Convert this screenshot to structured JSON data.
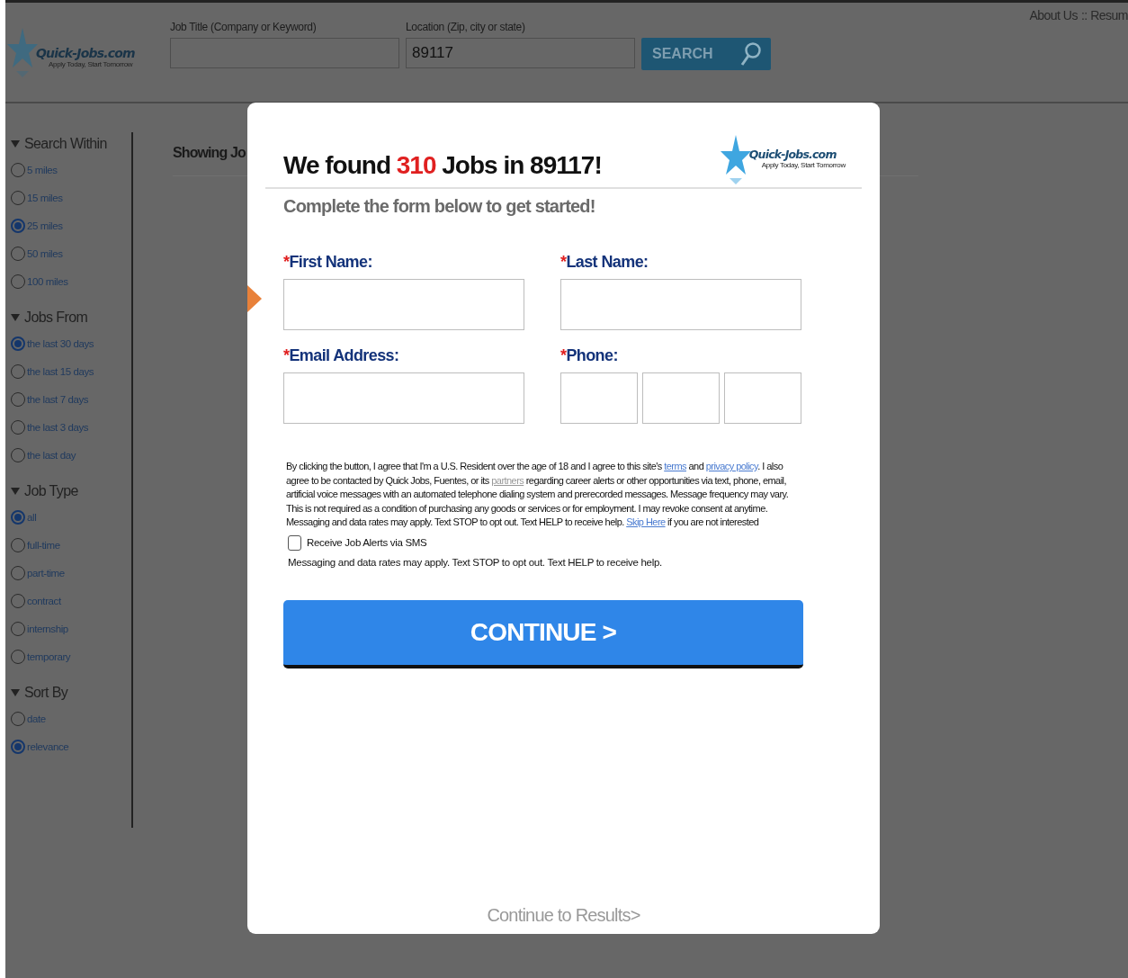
{
  "header": {
    "logo": {
      "name": "Quick-Jobs.com",
      "tagline": "Apply Today, Start Tomorrow"
    },
    "job_title_field": {
      "label": "Job Title (Company or Keyword)"
    },
    "location_field": {
      "label": "Location (Zip, city or state)",
      "value": "89117"
    },
    "search_button": "SEARCH",
    "top_links": [
      "About Us",
      ":: Resum"
    ]
  },
  "sidebar": [
    {
      "heading": "Search Within",
      "options": [
        {
          "label": "5 miles",
          "selected": false
        },
        {
          "label": "15 miles",
          "selected": false
        },
        {
          "label": "25 miles",
          "selected": true
        },
        {
          "label": "50 miles",
          "selected": false
        },
        {
          "label": "100 miles",
          "selected": false
        }
      ]
    },
    {
      "heading": "Jobs From",
      "options": [
        {
          "label": "the last 30 days",
          "selected": true
        },
        {
          "label": "the last 15 days",
          "selected": false
        },
        {
          "label": "the last 7 days",
          "selected": false
        },
        {
          "label": "the last 3 days",
          "selected": false
        },
        {
          "label": "the last day",
          "selected": false
        }
      ]
    },
    {
      "heading": "Job Type",
      "options": [
        {
          "label": "all",
          "selected": true
        },
        {
          "label": "full-time",
          "selected": false
        },
        {
          "label": "part-time",
          "selected": false
        },
        {
          "label": "contract",
          "selected": false
        },
        {
          "label": "internship",
          "selected": false
        },
        {
          "label": "temporary",
          "selected": false
        }
      ]
    },
    {
      "heading": "Sort By",
      "options": [
        {
          "label": "date",
          "selected": false
        },
        {
          "label": "relevance",
          "selected": true
        }
      ]
    }
  ],
  "main": {
    "heading": "Showing Jo"
  },
  "modal": {
    "title": {
      "before": "We found",
      "count": "310",
      "after": "Jobs in 89117!"
    },
    "logo": {
      "name": "Quick-Jobs.com",
      "tagline": "Apply Today, Start Tomorrow"
    },
    "subtitle": "Complete the form below to get started!",
    "fields": [
      {
        "kind": "text",
        "mark": "*",
        "label": "First Name:"
      },
      {
        "kind": "text",
        "mark": "*",
        "label": "Last Name:"
      },
      {
        "kind": "text",
        "mark": "*",
        "label": "Email Address:"
      },
      {
        "kind": "phone",
        "mark": "*",
        "label": "Phone:"
      }
    ],
    "disclaimer": [
      {
        "kind": "text",
        "text": "By clicking the button, I agree that I'm a U.S. Resident over the age of 18 and I agree to this site's "
      },
      {
        "kind": "link",
        "text": "terms"
      },
      {
        "kind": "text",
        "text": " and "
      },
      {
        "kind": "link",
        "text": "privacy policy"
      },
      {
        "kind": "text",
        "text": ". I also agree to be contacted by Quick Jobs, Fuentes, or its "
      },
      {
        "kind": "muted-link",
        "text": "partners"
      },
      {
        "kind": "text",
        "text": " regarding career alerts or other opportunities via text, phone, email, artificial voice messages with an automated telephone dialing system and prerecorded messages. Message frequency may vary. This is not required as a condition of purchasing any goods or services or for employment. I may revoke consent at anytime. Messaging and data rates may apply. Text STOP to opt out. Text HELP to receive help. "
      },
      {
        "kind": "link",
        "text": "Skip Here"
      },
      {
        "kind": "text",
        "text": " if you are not interested"
      }
    ],
    "sms_checkbox": {
      "label": "Receive Job Alerts via SMS",
      "checked": false
    },
    "sms_note": "Messaging and data rates may apply. Text STOP to opt out. Text HELP to receive help.",
    "continue_button": "CONTINUE >",
    "results_link": "Continue to Results>"
  }
}
